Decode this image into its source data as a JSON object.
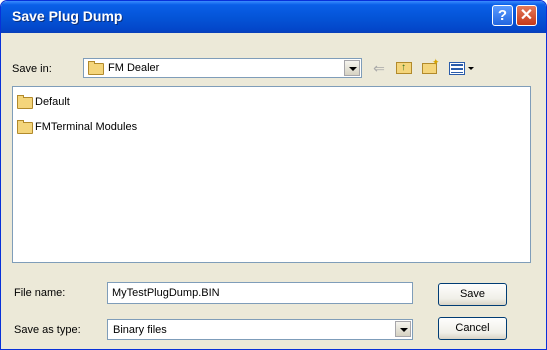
{
  "window": {
    "title": "Save Plug Dump"
  },
  "toolbar": {
    "save_in_label": "Save in:",
    "location": "FM Dealer",
    "icons": [
      "back-icon",
      "up-folder-icon",
      "new-folder-icon",
      "views-menu-icon"
    ]
  },
  "files": [
    {
      "name": "Default",
      "icon": "folder-icon"
    },
    {
      "name": "FMTerminal Modules",
      "icon": "folder-icon"
    }
  ],
  "form": {
    "file_name_label": "File name:",
    "file_name_value": "MyTestPlugDump.BIN",
    "save_type_label": "Save as type:",
    "save_type_value": "Binary files"
  },
  "buttons": {
    "save": "Save",
    "cancel": "Cancel"
  }
}
